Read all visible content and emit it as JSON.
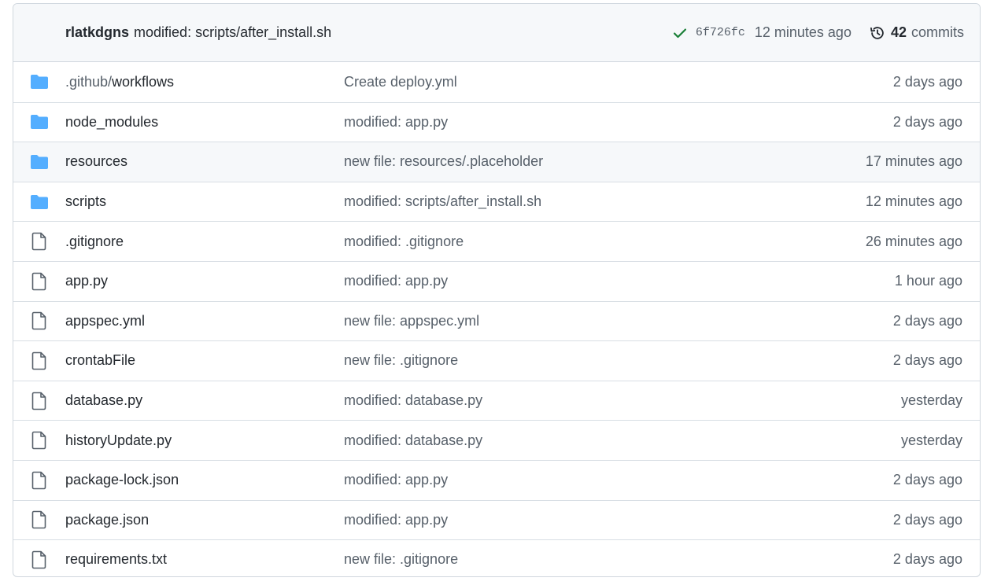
{
  "commit_bar": {
    "author": "rlatkdgns",
    "message": "modified: scripts/after_install.sh",
    "sha": "6f726fc",
    "time": "12 minutes ago",
    "commits_count": "42",
    "commits_label": "commits",
    "status_color": "#1a7f37"
  },
  "files": [
    {
      "type": "folder",
      "name_prefix": ".github/",
      "name": "workflows",
      "message": "Create deploy.yml",
      "age": "2 days ago"
    },
    {
      "type": "folder",
      "name_prefix": "",
      "name": "node_modules",
      "message": "modified: app.py",
      "age": "2 days ago"
    },
    {
      "type": "folder",
      "name_prefix": "",
      "name": "resources",
      "message": "new file: resources/.placeholder",
      "age": "17 minutes ago"
    },
    {
      "type": "folder",
      "name_prefix": "",
      "name": "scripts",
      "message": "modified: scripts/after_install.sh",
      "age": "12 minutes ago"
    },
    {
      "type": "file",
      "name_prefix": "",
      "name": ".gitignore",
      "message": "modified: .gitignore",
      "age": "26 minutes ago"
    },
    {
      "type": "file",
      "name_prefix": "",
      "name": "app.py",
      "message": "modified: app.py",
      "age": "1 hour ago"
    },
    {
      "type": "file",
      "name_prefix": "",
      "name": "appspec.yml",
      "message": "new file: appspec.yml",
      "age": "2 days ago"
    },
    {
      "type": "file",
      "name_prefix": "",
      "name": "crontabFile",
      "message": "new file: .gitignore",
      "age": "2 days ago"
    },
    {
      "type": "file",
      "name_prefix": "",
      "name": "database.py",
      "message": "modified: database.py",
      "age": "yesterday"
    },
    {
      "type": "file",
      "name_prefix": "",
      "name": "historyUpdate.py",
      "message": "modified: database.py",
      "age": "yesterday"
    },
    {
      "type": "file",
      "name_prefix": "",
      "name": "package-lock.json",
      "message": "modified: app.py",
      "age": "2 days ago"
    },
    {
      "type": "file",
      "name_prefix": "",
      "name": "package.json",
      "message": "modified: app.py",
      "age": "2 days ago"
    },
    {
      "type": "file",
      "name_prefix": "",
      "name": "requirements.txt",
      "message": "new file: .gitignore",
      "age": "2 days ago"
    }
  ],
  "icons": {
    "folder": "folder-icon",
    "file": "file-icon",
    "check": "check-icon",
    "history": "history-icon"
  },
  "colors": {
    "folder": "#54aeff",
    "file_icon": "#57606a",
    "hover_row": "#f6f8fa"
  }
}
